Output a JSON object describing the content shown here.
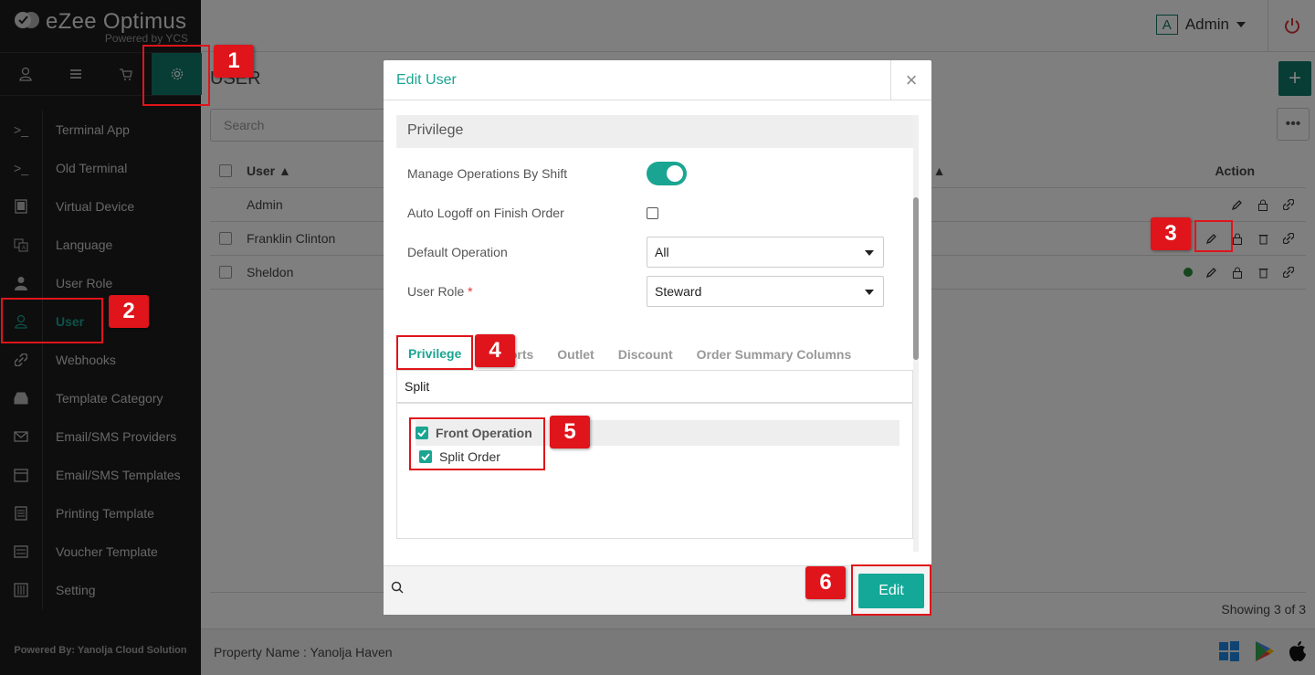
{
  "app": {
    "brand_title": "eZee Optimus",
    "brand_sub": "Powered by YCS",
    "footer_text": "Powered By: Yanolja Cloud Solution"
  },
  "sidebar": {
    "top_icons": [
      "user-icon",
      "list-icon",
      "cart-icon",
      "gear-icon"
    ],
    "items": [
      {
        "label": "Terminal App",
        "icon": "terminal-icon"
      },
      {
        "label": "Old Terminal",
        "icon": "terminal-icon"
      },
      {
        "label": "Virtual Device",
        "icon": "tablet-icon"
      },
      {
        "label": "Language",
        "icon": "language-icon"
      },
      {
        "label": "User Role",
        "icon": "user-role-icon"
      },
      {
        "label": "User",
        "icon": "user-icon",
        "active": true
      },
      {
        "label": "Webhooks",
        "icon": "link-icon"
      },
      {
        "label": "Template Category",
        "icon": "inbox-icon"
      },
      {
        "label": "Email/SMS Providers",
        "icon": "envelope-icon"
      },
      {
        "label": "Email/SMS Templates",
        "icon": "calendar-icon"
      },
      {
        "label": "Printing Template",
        "icon": "receipt-icon"
      },
      {
        "label": "Voucher Template",
        "icon": "voucher-icon"
      },
      {
        "label": "Setting",
        "icon": "sliders-icon"
      }
    ]
  },
  "header": {
    "admin_badge": "A",
    "admin_name": "Admin"
  },
  "page": {
    "title": "USER",
    "search_placeholder": "Search",
    "add_label": "+",
    "more_label": "•••",
    "columns": {
      "user": "User ▲",
      "col2": "e ▲",
      "action": "Action"
    },
    "rows": [
      {
        "name": "Admin",
        "checkbox": false
      },
      {
        "name": "Franklin Clinton",
        "checkbox": true
      },
      {
        "name": "Sheldon",
        "checkbox": true
      }
    ],
    "showing": "Showing 3 of 3",
    "property_name": "Property Name : Yanolja Haven"
  },
  "modal": {
    "title": "Edit User",
    "close": "×",
    "section": "Privilege",
    "fields": {
      "manage_ops_label": "Manage Operations By Shift",
      "manage_ops_value": true,
      "auto_logoff_label": "Auto Logoff on Finish Order",
      "auto_logoff_value": false,
      "default_op_label": "Default Operation",
      "default_op_value": "All",
      "user_role_label": "User Role",
      "user_role_required": "*",
      "user_role_value": "Steward"
    },
    "tabs": [
      "Privilege",
      "Reports",
      "Outlet",
      "Discount",
      "Order Summary Columns"
    ],
    "active_tab": "Privilege",
    "filter_value": "Split",
    "tree": {
      "parent": "Front Operation",
      "child": "Split Order"
    },
    "edit_button": "Edit"
  },
  "annotations": [
    "1",
    "2",
    "3",
    "4",
    "5",
    "6"
  ],
  "colors": {
    "accent": "#1aa592",
    "annotation": "#e0141b",
    "sidebar_bg": "#1c1c1c"
  }
}
